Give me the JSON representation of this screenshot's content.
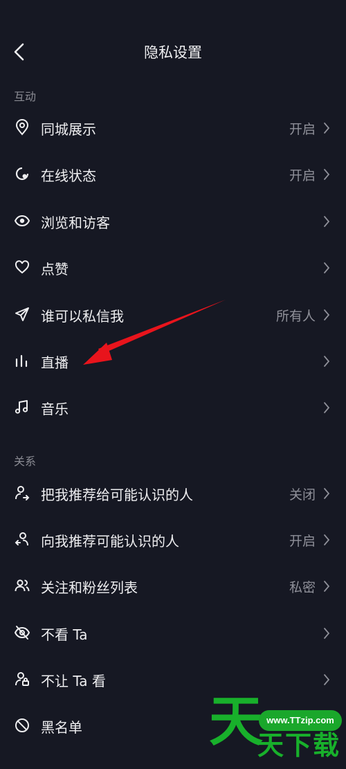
{
  "header": {
    "title": "隐私设置",
    "back_icon": "chevron-left-icon"
  },
  "sections": [
    {
      "label": "互动",
      "items": [
        {
          "label": "同城展示",
          "value": "开启",
          "icon": "location-pin-icon"
        },
        {
          "label": "在线状态",
          "value": "开启",
          "icon": "online-status-icon"
        },
        {
          "label": "浏览和访客",
          "value": "",
          "icon": "eye-icon"
        },
        {
          "label": "点赞",
          "value": "",
          "icon": "heart-icon"
        },
        {
          "label": "谁可以私信我",
          "value": "所有人",
          "icon": "send-message-icon"
        },
        {
          "label": "直播",
          "value": "",
          "icon": "live-bars-icon"
        },
        {
          "label": "音乐",
          "value": "",
          "icon": "music-note-icon"
        }
      ]
    },
    {
      "label": "关系",
      "items": [
        {
          "label": "把我推荐给可能认识的人",
          "value": "关闭",
          "icon": "share-user-icon"
        },
        {
          "label": "向我推荐可能认识的人",
          "value": "开启",
          "icon": "recommend-user-icon"
        },
        {
          "label": "关注和粉丝列表",
          "value": "私密",
          "icon": "users-icon"
        },
        {
          "label": "不看 Ta",
          "value": "",
          "icon": "eye-off-icon"
        },
        {
          "label": "不让 Ta 看",
          "value": "",
          "icon": "user-lock-icon"
        },
        {
          "label": "黑名单",
          "value": "",
          "icon": "block-icon"
        }
      ]
    }
  ],
  "annotation": {
    "color": "#e8141c"
  },
  "watermark": {
    "url_text": "www.TTzip.com",
    "big_char": "天",
    "sub_text": "天下载",
    "color": "#18b02b"
  }
}
